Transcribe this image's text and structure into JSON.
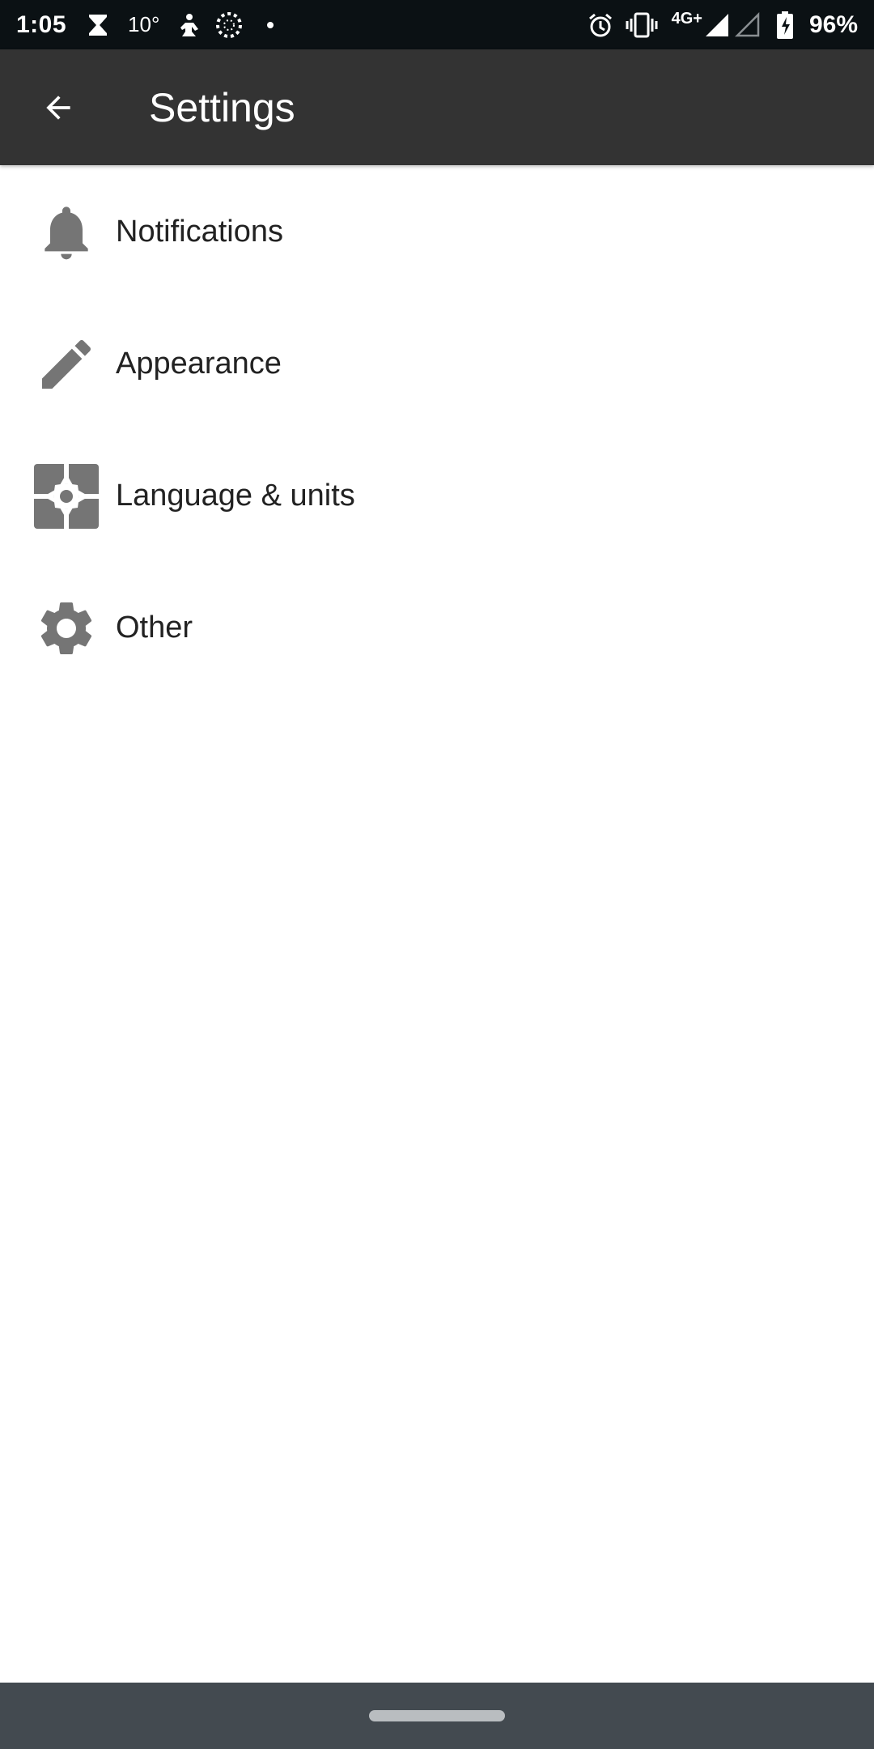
{
  "status_bar": {
    "time": "1:05",
    "temperature": "10°",
    "network": "4G+",
    "battery": "96%",
    "icons": [
      "hourglass-icon",
      "weather-icon",
      "fitness-icon",
      "loading-ring-icon",
      "dot-icon",
      "alarm-icon",
      "vibrate-icon",
      "signal-icon",
      "signal-empty-icon",
      "battery-charging-icon"
    ]
  },
  "app_bar": {
    "title": "Settings",
    "back_icon": "arrow-back-icon"
  },
  "settings": {
    "items": [
      {
        "label": "Notifications",
        "icon": "bell-icon"
      },
      {
        "label": "Appearance",
        "icon": "pencil-icon"
      },
      {
        "label": "Language & units",
        "icon": "puzzle-icon"
      },
      {
        "label": "Other",
        "icon": "gear-icon"
      }
    ]
  },
  "colors": {
    "status_bar": "#0b1114",
    "app_bar": "#333333",
    "icon_gray": "#757575",
    "text": "#222222",
    "nav_bar": "#434a50"
  }
}
